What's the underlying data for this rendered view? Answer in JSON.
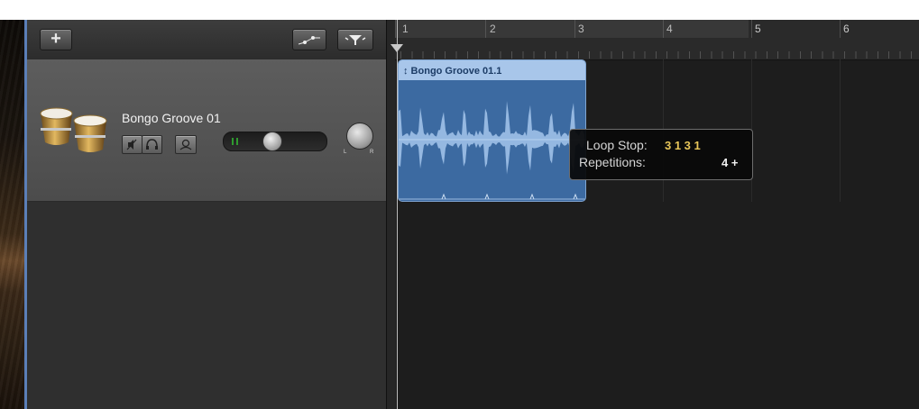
{
  "header": {
    "add_label": "+"
  },
  "track": {
    "name": "Bongo Groove 01",
    "pan_left": "L",
    "pan_right": "R"
  },
  "ruler": {
    "bars": [
      "1",
      "2",
      "3",
      "4",
      "5",
      "6"
    ]
  },
  "region": {
    "title": "↕ Bongo Groove 01.1"
  },
  "tooltip": {
    "loop_stop_label": "Loop Stop:",
    "loop_stop_value": "3 1 3 1",
    "repetitions_label": "Repetitions:",
    "repetitions_value": "4 +"
  },
  "colors": {
    "region_body": "#3c6aa1",
    "region_header": "#a8c6ea",
    "loop_stop_value": "#e8c65a",
    "accent_edge": "#5b7fb8"
  },
  "icons": [
    "add-icon",
    "automation-icon",
    "filter-icon",
    "bongo-drums-icon",
    "mute-icon",
    "headphones-icon",
    "record-enable-icon",
    "pan-knob-icon",
    "playhead-icon"
  ]
}
